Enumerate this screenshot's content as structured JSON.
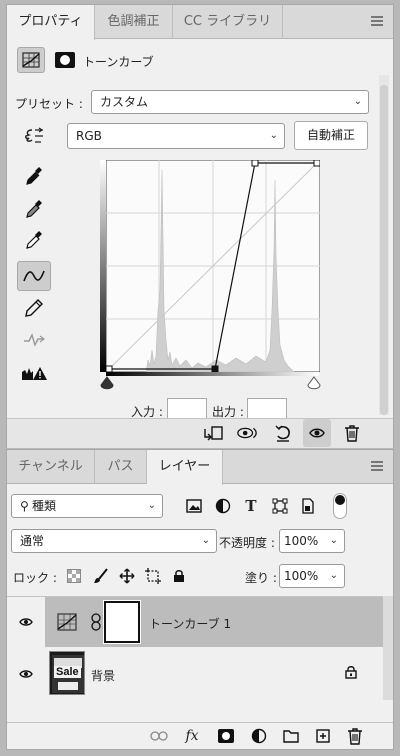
{
  "properties_tabs": [
    {
      "label": "プロパティ",
      "active": true
    },
    {
      "label": "色調補正",
      "active": false
    },
    {
      "label": "CC ライブラリ",
      "active": false
    }
  ],
  "adjustment": {
    "title": "トーンカーブ"
  },
  "preset": {
    "label": "プリセット :",
    "value": "カスタム"
  },
  "channel": {
    "value": "RGB"
  },
  "auto_button": "自動補正",
  "io": {
    "input_label": "入力 :",
    "input_value": "",
    "output_label": "出力 :",
    "output_value": ""
  },
  "tools": [
    "eyedropper-black-icon",
    "eyedropper-gray-icon",
    "eyedropper-white-icon",
    "curve-points-icon",
    "pencil-icon",
    "smooth-icon",
    "clipping-warning-icon"
  ],
  "props_footer_icons": [
    "clip-to-layer-icon",
    "view-previous-icon",
    "reset-icon",
    "visibility-icon",
    "trash-icon"
  ],
  "layers_tabs": [
    {
      "label": "チャンネル",
      "active": false
    },
    {
      "label": "パス",
      "active": false
    },
    {
      "label": "レイヤー",
      "active": true
    }
  ],
  "filter": {
    "value": "種類"
  },
  "blend": {
    "mode": "通常",
    "opacity_label": "不透明度 :",
    "opacity_value": "100%"
  },
  "lock": {
    "label": "ロック :",
    "fill_label": "塗り :",
    "fill_value": "100%"
  },
  "layers": [
    {
      "name": "トーンカーブ 1",
      "selected": true,
      "visible": true,
      "locked": false
    },
    {
      "name": "背景",
      "selected": false,
      "visible": true,
      "locked": true
    }
  ],
  "layers_footer_icons": [
    "link-icon",
    "fx-icon",
    "mask-icon",
    "adjustment-icon",
    "folder-icon",
    "new-layer-icon",
    "trash-icon"
  ],
  "bg_thumb_text": [
    "Sale"
  ],
  "colors": {
    "panel": "#f0f0f0",
    "tab_inactive": "#d9d9d9",
    "selected_row": "#bcbcbc"
  }
}
